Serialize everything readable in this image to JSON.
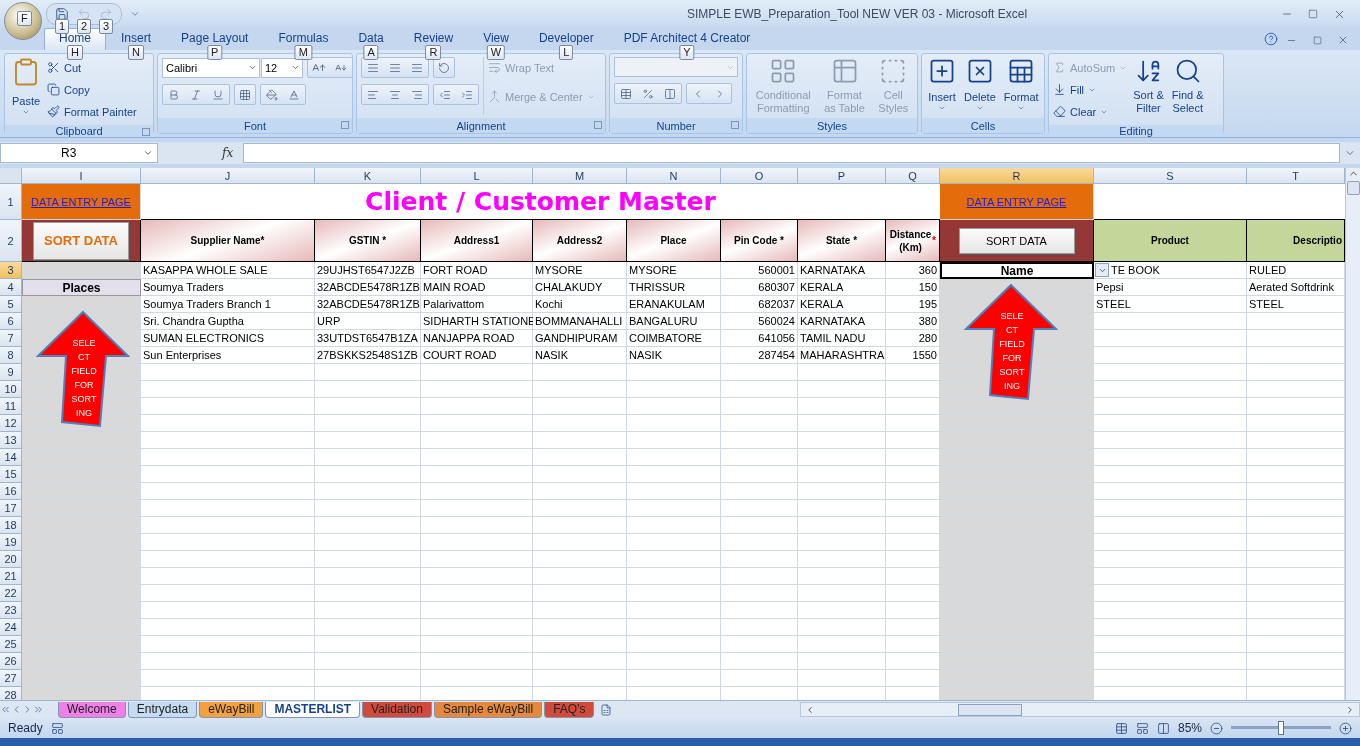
{
  "window": {
    "title": "SIMPLE EWB_Preparation_Tool NEW VER 03 - Microsoft Excel",
    "office_keytip": "F",
    "quick_access": [
      {
        "keytip": "1",
        "disabled": false
      },
      {
        "keytip": "2",
        "disabled": true
      },
      {
        "keytip": "3",
        "disabled": true
      }
    ]
  },
  "tabs": [
    {
      "label": "Home",
      "keytip": "H",
      "selected": true
    },
    {
      "label": "Insert",
      "keytip": "N",
      "selected": false
    },
    {
      "label": "Page Layout",
      "keytip": "P",
      "selected": false
    },
    {
      "label": "Formulas",
      "keytip": "M",
      "selected": false
    },
    {
      "label": "Data",
      "keytip": "A",
      "selected": false
    },
    {
      "label": "Review",
      "keytip": "R",
      "selected": false
    },
    {
      "label": "View",
      "keytip": "W",
      "selected": false
    },
    {
      "label": "Developer",
      "keytip": "L",
      "selected": false
    },
    {
      "label": "PDF Architect 4 Creator",
      "keytip": "Y",
      "selected": false
    }
  ],
  "ribbon": {
    "clipboard": {
      "label": "Clipboard",
      "paste": "Paste",
      "cut": "Cut",
      "copy": "Copy",
      "format_painter": "Format Painter"
    },
    "font": {
      "label": "Font",
      "face": "Calibri",
      "size": "12"
    },
    "alignment": {
      "label": "Alignment",
      "wrap_text": {
        "label": "Wrap Text",
        "disabled": true
      },
      "merge": {
        "label": "Merge & Center",
        "disabled": true
      }
    },
    "number": {
      "label": "Number"
    },
    "styles": {
      "label": "Styles",
      "buttons": [
        {
          "label": "Conditional\nFormatting",
          "disabled": true
        },
        {
          "label": "Format\nas Table",
          "disabled": true
        },
        {
          "label": "Cell\nStyles",
          "disabled": true
        }
      ]
    },
    "cells": {
      "label": "Cells",
      "buttons": [
        {
          "label": "Insert",
          "disabled": false
        },
        {
          "label": "Delete",
          "disabled": false
        },
        {
          "label": "Format",
          "disabled": false
        }
      ]
    },
    "editing": {
      "label": "Editing",
      "autosum": {
        "label": "AutoSum",
        "disabled": true
      },
      "fill": {
        "label": "Fill",
        "disabled": false
      },
      "clear": {
        "label": "Clear",
        "disabled": false
      },
      "sort": {
        "label": "Sort &\nFilter",
        "disabled": false
      },
      "find": {
        "label": "Find &\nSelect",
        "disabled": false
      }
    }
  },
  "formula_bar": {
    "name_box": "R3",
    "function_label": "fx"
  },
  "sheet": {
    "columns": [
      {
        "letter": "I",
        "selected": false
      },
      {
        "letter": "J",
        "selected": false
      },
      {
        "letter": "K",
        "selected": false
      },
      {
        "letter": "L",
        "selected": false
      },
      {
        "letter": "M",
        "selected": false
      },
      {
        "letter": "N",
        "selected": false
      },
      {
        "letter": "O",
        "selected": false
      },
      {
        "letter": "P",
        "selected": false
      },
      {
        "letter": "Q",
        "selected": false
      },
      {
        "letter": "R",
        "selected": true
      },
      {
        "letter": "S",
        "selected": false
      },
      {
        "letter": "T",
        "selected": false
      }
    ],
    "rows": [
      {
        "number": "1",
        "selected": false
      },
      {
        "number": "2",
        "selected": false
      },
      {
        "number": "3",
        "selected": true
      },
      {
        "number": "4",
        "selected": false
      },
      {
        "number": "5",
        "selected": false
      },
      {
        "number": "6",
        "selected": false
      },
      {
        "number": "7",
        "selected": false
      },
      {
        "number": "8",
        "selected": false
      },
      {
        "number": "9",
        "selected": false
      },
      {
        "number": "10",
        "selected": false
      },
      {
        "number": "11",
        "selected": false
      },
      {
        "number": "12",
        "selected": false
      },
      {
        "number": "13",
        "selected": false
      },
      {
        "number": "14",
        "selected": false
      },
      {
        "number": "15",
        "selected": false
      },
      {
        "number": "16",
        "selected": false
      },
      {
        "number": "17",
        "selected": false
      },
      {
        "number": "18",
        "selected": false
      },
      {
        "number": "19",
        "selected": false
      },
      {
        "number": "20",
        "selected": false
      },
      {
        "number": "21",
        "selected": false
      },
      {
        "number": "22",
        "selected": false
      },
      {
        "number": "23",
        "selected": false
      },
      {
        "number": "24",
        "selected": false
      },
      {
        "number": "25",
        "selected": false
      },
      {
        "number": "26",
        "selected": false
      },
      {
        "number": "27",
        "selected": false
      },
      {
        "number": "28",
        "selected": false
      }
    ],
    "title": "Client / Customer Master",
    "left_panel": {
      "link": "DATA ENTRY PAGE",
      "button": "SORT DATA",
      "field": "Places",
      "arrow_text": "SELE CT FIELD FOR SORT ING"
    },
    "right_panel": {
      "link": "DATA ENTRY PAGE",
      "button": "SORT DATA",
      "field": "Name",
      "arrow_text": "SELE CT FIELD FOR SORT ING"
    },
    "headers": [
      {
        "label": "Supplier Name*"
      },
      {
        "label": "GSTIN *"
      },
      {
        "label": "Address1"
      },
      {
        "label": "Address2"
      },
      {
        "label": "Place"
      },
      {
        "label": "Pin Code *"
      },
      {
        "label": "State *"
      },
      {
        "label": "Distance (Km)",
        "note": "*"
      }
    ],
    "records": [
      [
        "KASAPPA WHOLE SALE",
        "29UJHST6547J2ZB",
        "FORT ROAD",
        "MYSORE",
        "MYSORE",
        "560001",
        "KARNATAKA",
        "360"
      ],
      [
        "Soumya Traders",
        "32ABCDE5478R1ZB",
        "MAIN ROAD",
        "CHALAKUDY",
        "THRISSUR",
        "680307",
        "KERALA",
        "150"
      ],
      [
        "Soumya Traders Branch 1",
        "32ABCDE5478R1ZB",
        "Palarivattom",
        "Kochi",
        "ERANAKULAM",
        "682037",
        "KERALA",
        "195"
      ],
      [
        "Sri. Chandra Guptha",
        "URP",
        "SIDHARTH STATIONE",
        "BOMMANAHALLI",
        "BANGALURU",
        "560024",
        "KARNATAKA",
        "380"
      ],
      [
        "SUMAN ELECTRONICS",
        "33UTDST6547B1ZA",
        "NANJAPPA ROAD",
        "GANDHIPURAM",
        "COIMBATORE",
        "641056",
        "TAMIL NADU",
        "280"
      ],
      [
        "Sun Enterprises",
        "27BSKKS2548S1ZB",
        "COURT ROAD",
        "NASIK",
        "NASIK",
        "287454",
        "MAHARASHTRA",
        "1550"
      ]
    ],
    "products": {
      "headers": [
        "Product",
        "Descriptio"
      ],
      "rows": [
        [
          "TE BOOK",
          "RULED"
        ],
        [
          "Pepsi",
          "Aerated Softdrink"
        ],
        [
          "STEEL",
          "STEEL"
        ]
      ]
    }
  },
  "sheet_tabs": [
    {
      "label": "Welcome",
      "color": "#f080e8",
      "selected": false
    },
    {
      "label": "Entrydata",
      "color": "#c6dcf4",
      "selected": false
    },
    {
      "label": "eWayBill",
      "color": "#f2a040",
      "selected": false
    },
    {
      "label": "MASTERLIST",
      "color": "#ffffff",
      "selected": true
    },
    {
      "label": "Validation",
      "color": "#d24a3c",
      "selected": false
    },
    {
      "label": "Sample eWayBill",
      "color": "#e8883a",
      "selected": false
    },
    {
      "label": "FAQ's",
      "color": "#d24a3c",
      "selected": false
    }
  ],
  "status_bar": {
    "status": "Ready",
    "zoom": "85%",
    "zoom_level": {
      "level": 0.5
    }
  }
}
